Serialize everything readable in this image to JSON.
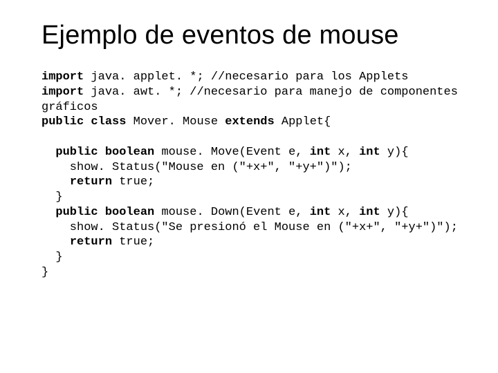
{
  "title": "Ejemplo de eventos de mouse",
  "code": {
    "kw_import1": "import",
    "l1_rest": " java. applet. *; //necesario para los Applets",
    "kw_import2": "import",
    "l2_rest": " java. awt. *; //necesario para manejo de componentes",
    "l3": "gráficos",
    "kw_public1": "public",
    "kw_class": "class",
    "l4_name": " Mover. Mouse ",
    "kw_extends": "extends",
    "l4_tail": " Applet{",
    "blank": "",
    "indent1": "  ",
    "kw_public2": "public",
    "kw_boolean1": "boolean",
    "l6_sig": " mouse. Move(Event e, ",
    "kw_int1": "int",
    "l6_x": " x, ",
    "kw_int2": "int",
    "l6_y": " y){",
    "l7": "    show. Status(\"Mouse en (\"+x+\", \"+y+\")\");",
    "l8_pre": "    ",
    "kw_return1": "return",
    "l8_post": " true;",
    "l9": "  }",
    "kw_public3": "public",
    "kw_boolean2": "boolean",
    "l10_sig": " mouse. Down(Event e, ",
    "kw_int3": "int",
    "l10_x": " x, ",
    "kw_int4": "int",
    "l10_y": " y){",
    "l11": "    show. Status(\"Se presionó el Mouse en (\"+x+\", \"+y+\")\");",
    "l12_pre": "    ",
    "kw_return2": "return",
    "l12_post": " true;",
    "l13": "  }",
    "l14": "}"
  }
}
